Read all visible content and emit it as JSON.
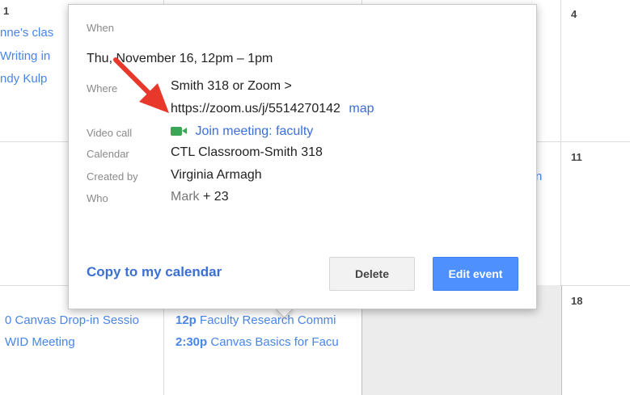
{
  "calendar": {
    "day_numbers": {
      "top_left": "1",
      "top_right": "4",
      "mid_right": "11",
      "bottom_right": "18"
    },
    "top_left_events": [
      "nne's clas",
      "Writing in",
      "ndy Kulp"
    ],
    "mid_right_snippet": "n",
    "bottom_left_events": [
      "0 Canvas Drop-in Sessio",
      "WID Meeting"
    ],
    "bottom_mid_events": [
      {
        "time": "12p",
        "title": "Faculty Research Commi"
      },
      {
        "time": "2:30p",
        "title": "Canvas Basics for Facu"
      }
    ]
  },
  "popup": {
    "when_label": "When",
    "when_value": "Thu, November 16, 12pm – 1pm",
    "where_label": "Where",
    "where_line1": "Smith 318 or Zoom >",
    "where_line2": "https://zoom.us/j/5514270142",
    "map_link": "map",
    "video_label": "Video call",
    "video_link": "Join meeting: faculty",
    "calendar_label": "Calendar",
    "calendar_value": "CTL Classroom-Smith 318",
    "created_label": "Created by",
    "created_value": "Virginia Armagh",
    "who_label": "Who",
    "who_name": "Mark",
    "who_extra": "+ 23",
    "copy_link": "Copy to my calendar",
    "delete_button": "Delete",
    "edit_button": "Edit event"
  },
  "colors": {
    "link": "#3b6fd4",
    "event_text": "#4a86e8",
    "primary_button": "#4d90fe",
    "video_icon": "#3aa757",
    "annotation_arrow": "#e8382c"
  },
  "icons": {
    "video": "video-camera-icon",
    "annotation": "red-arrow-annotation"
  }
}
